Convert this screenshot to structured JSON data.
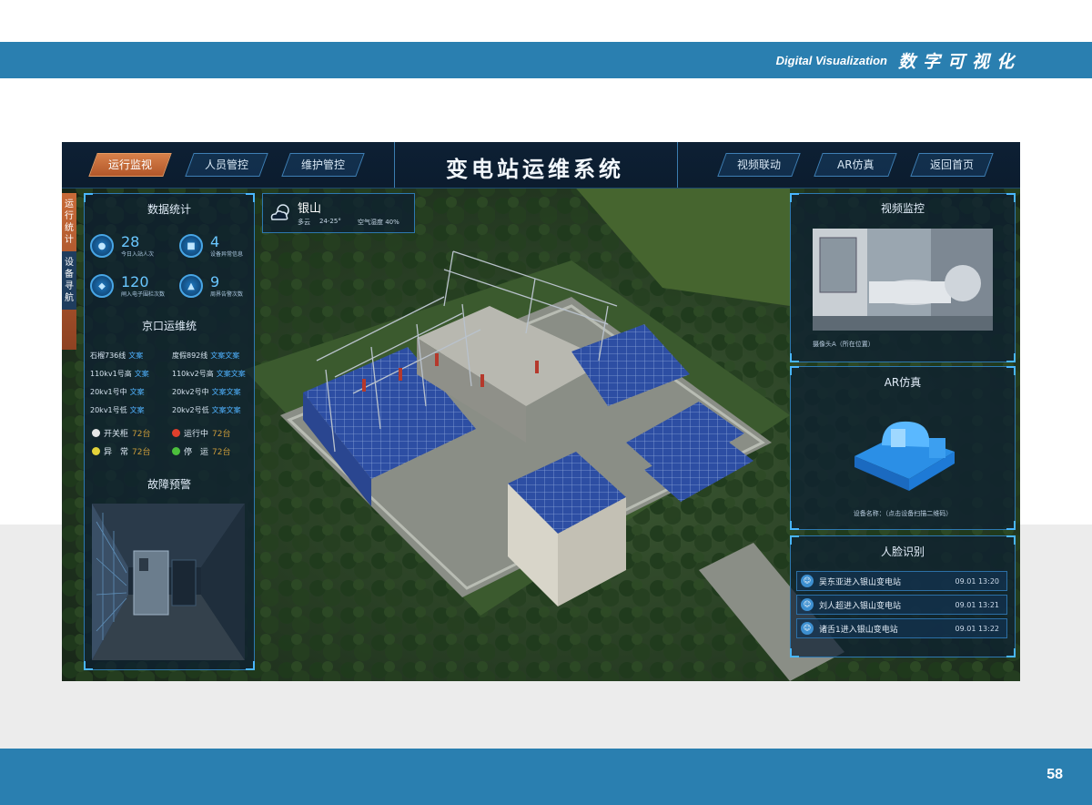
{
  "brand": {
    "en": "Digital Visualization",
    "cn": "数字可视化"
  },
  "page_number": "58",
  "nav": {
    "left": [
      "运行监视",
      "人员管控",
      "维护管控"
    ],
    "right": [
      "视频联动",
      "AR仿真",
      "返回首页"
    ],
    "active": "运行监视"
  },
  "system_title": "变电站运维系统",
  "side_tabs": [
    "运行统计",
    "设备寻航"
  ],
  "weather": {
    "city": "银山",
    "condition": "多云",
    "temp": "24-25°",
    "humidity": "空气湿度 40%"
  },
  "stats": {
    "title": "数据统计",
    "items": [
      {
        "value": "28",
        "label": "今日入站人次",
        "icon": "person-icon"
      },
      {
        "value": "4",
        "label": "设备异常信息",
        "icon": "device-icon"
      },
      {
        "value": "120",
        "label": "闸入电子围栏次数",
        "icon": "fence-icon"
      },
      {
        "value": "9",
        "label": "周界告警次数",
        "icon": "alarm-icon"
      }
    ]
  },
  "lines": {
    "title": "京口运维统",
    "rows": [
      {
        "name": "石榴736线",
        "status": "文案"
      },
      {
        "name": "度假892线",
        "status": "文案文案"
      },
      {
        "name": "110kv1号高",
        "status": "文案"
      },
      {
        "name": "110kv2号高",
        "status": "文案文案"
      },
      {
        "name": "20kv1号中",
        "status": "文案"
      },
      {
        "name": "20kv2号中",
        "status": "文案文案"
      },
      {
        "name": "20kv1号低",
        "status": "文案"
      },
      {
        "name": "20kv2号低",
        "status": "文案文案"
      }
    ],
    "legend": [
      {
        "label": "开关柜",
        "count": "72台",
        "color": "#e6e6e6"
      },
      {
        "label": "运行中",
        "count": "72台",
        "color": "#e0402c"
      },
      {
        "label": "异　常",
        "count": "72台",
        "color": "#e3d23a"
      },
      {
        "label": "停　运",
        "count": "72台",
        "color": "#4cbf3c"
      }
    ]
  },
  "fault": {
    "title": "故障预警"
  },
  "video": {
    "title": "视频监控",
    "caption": "摄像头A（所在位置）"
  },
  "ar": {
    "title": "AR仿真",
    "caption": "设备名称：（点击设备扫描二维码）"
  },
  "face": {
    "title": "人脸识别",
    "rows": [
      {
        "text": "吴东亚进入银山变电站",
        "time": "09.01 13:20"
      },
      {
        "text": "刘人超进入银山变电站",
        "time": "09.01 13:21"
      },
      {
        "text": "诸舌1进入银山变电站",
        "time": "09.01 13:22"
      }
    ]
  }
}
